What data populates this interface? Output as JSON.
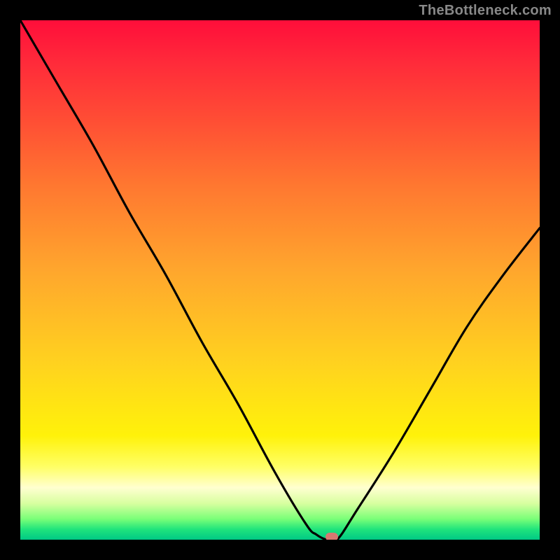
{
  "watermark": "TheBottleneck.com",
  "colors": {
    "curve": "#000000",
    "marker": "#d77771",
    "frame": "#000000"
  },
  "chart_data": {
    "type": "line",
    "title": "",
    "xlabel": "",
    "ylabel": "",
    "xlim": [
      0,
      100
    ],
    "ylim": [
      0,
      100
    ],
    "grid": false,
    "series": [
      {
        "name": "bottleneck-curve",
        "x": [
          0,
          7,
          14,
          21,
          28,
          35,
          42,
          49,
          55,
          57,
          59,
          61,
          65,
          72,
          79,
          86,
          93,
          100
        ],
        "values": [
          100,
          88,
          76,
          63,
          51,
          38,
          26,
          13,
          3,
          1,
          0,
          0,
          6,
          17,
          29,
          41,
          51,
          60
        ]
      }
    ],
    "marker": {
      "x": 60,
      "y": 0
    },
    "background_gradient": {
      "orientation": "vertical",
      "stops": [
        {
          "pos": 0.0,
          "color": "#ff0e3a"
        },
        {
          "pos": 0.2,
          "color": "#ff5034"
        },
        {
          "pos": 0.48,
          "color": "#ffa62d"
        },
        {
          "pos": 0.8,
          "color": "#fff20a"
        },
        {
          "pos": 0.9,
          "color": "#ffffd0"
        },
        {
          "pos": 1.0,
          "color": "#00c985"
        }
      ]
    }
  }
}
